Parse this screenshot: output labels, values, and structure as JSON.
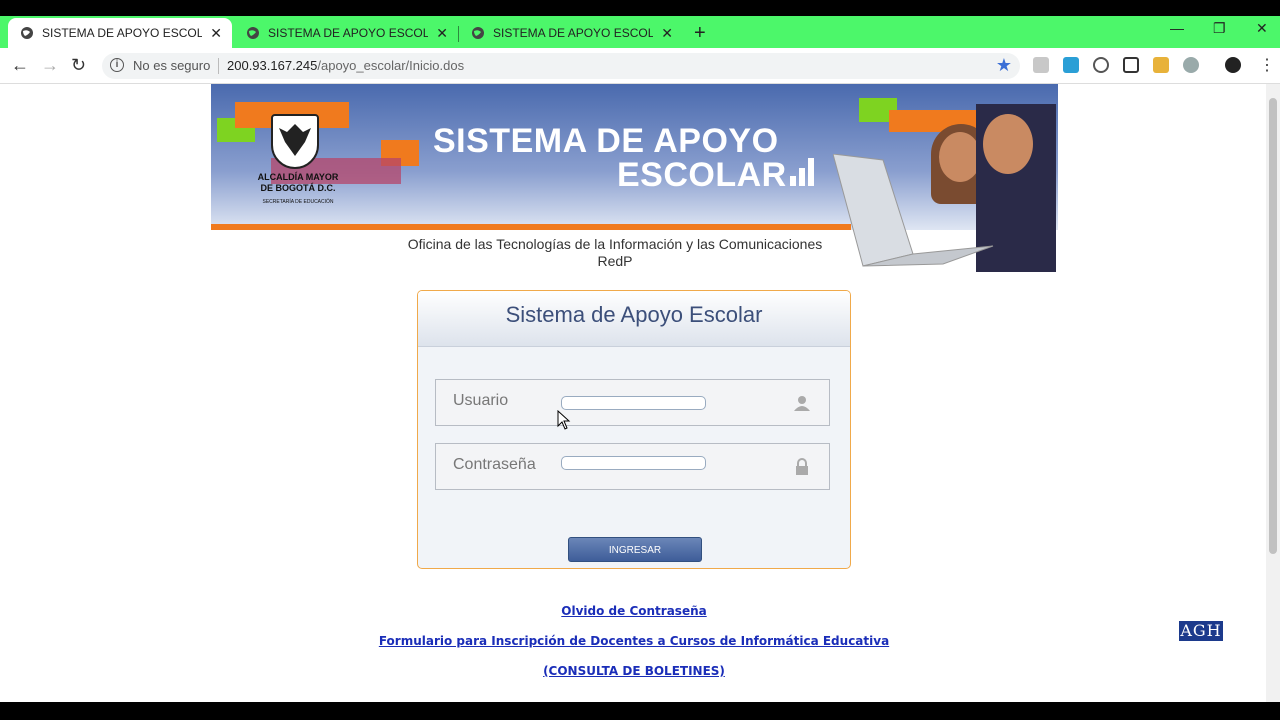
{
  "browser": {
    "tabs": [
      {
        "title": "SISTEMA DE APOYO ESCOLAR -L",
        "active": true
      },
      {
        "title": "SISTEMA DE APOYO ESCOLAR -L",
        "active": false
      },
      {
        "title": "SISTEMA DE APOYO ESCOLAR - !",
        "active": false
      }
    ],
    "new_tab": "+",
    "security_label": "No es seguro",
    "url_host": "200.93.167.245",
    "url_path": "/apoyo_escolar/Inicio.dos",
    "colors": {
      "tabbar": "#4cf76a",
      "star": "#3b6fd6"
    }
  },
  "banner": {
    "title_line1": "SISTEMA DE APOYO",
    "title_line2": "ESCOLAR",
    "logo_line1": "ALCALDÍA MAYOR",
    "logo_line2": "DE BOGOTÁ D.C.",
    "logo_line3": "SECRETARÍA DE EDUCACIÓN",
    "office_line1": "Oficina de las Tecnologías de la Información y las Comunicaciones",
    "office_line2": "RedP"
  },
  "login": {
    "title": "Sistema de Apoyo Escolar",
    "user_label": "Usuario",
    "user_value": "",
    "password_label": "Contraseña",
    "password_value": "",
    "submit_label": "INGRESAR",
    "colors": {
      "border": "#f0a94a",
      "title": "#3c4f7a",
      "button": "#3e5d99"
    }
  },
  "links": {
    "forgot": "Olvido de Contraseña",
    "form": "Formulario para Inscripción de Docentes a Cursos de Informática Educativa",
    "bulletins": "(CONSULTA DE BOLETINES)"
  },
  "watermark": "AGH"
}
